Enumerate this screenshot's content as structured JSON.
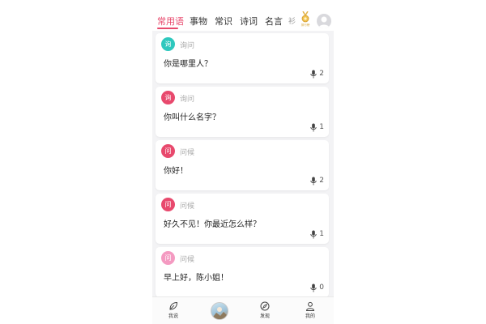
{
  "tabs": [
    {
      "label": "常用语",
      "active": true
    },
    {
      "label": "事物",
      "active": false
    },
    {
      "label": "常识",
      "active": false
    },
    {
      "label": "诗词",
      "active": false
    },
    {
      "label": "名言",
      "active": false
    }
  ],
  "tab_more": "衫",
  "rank_label": "排行榜",
  "cards": [
    {
      "badge": "询",
      "category": "询问",
      "text": "你是哪里人？",
      "count": "2",
      "badge_color": "#2ec8be"
    },
    {
      "badge": "询",
      "category": "询问",
      "text": "你叫什么名字？",
      "count": "1",
      "badge_color": "#e8496d"
    },
    {
      "badge": "问",
      "category": "问候",
      "text": "你好！",
      "count": "2",
      "badge_color": "#e8496d"
    },
    {
      "badge": "问",
      "category": "问候",
      "text": "好久不见！你最近怎么样？",
      "count": "1",
      "badge_color": "#e8496d"
    },
    {
      "badge": "问",
      "category": "问候",
      "text": "早上好，陈小姐！",
      "count": "0",
      "badge_color": "#f49ac1"
    }
  ],
  "bottom_nav": {
    "say_label": "我说",
    "discover_label": "发现",
    "me_label": "我的"
  },
  "colors": {
    "accent": "#e8496d",
    "teal_badge": "#2ec8be",
    "pink_badge": "#f49ac1",
    "background": "#f3f3f5"
  }
}
